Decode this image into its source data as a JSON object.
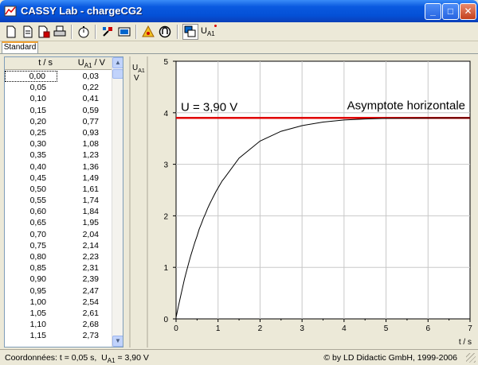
{
  "window": {
    "title": "CASSY Lab - chargeCG2",
    "minimize": "_",
    "maximize": "□",
    "close": "✕"
  },
  "toolbar": {
    "buttons": [
      "new-file-icon",
      "open-file-icon",
      "save-file-icon",
      "print-icon",
      "stopwatch-icon",
      "settings-icon",
      "display-icon",
      "parameters-icon",
      "control-icon",
      "window-icon"
    ],
    "channel_label": "U",
    "channel_sub": "A1"
  },
  "tabs": [
    {
      "label": "Standard"
    }
  ],
  "table": {
    "col1_header": "t / s",
    "col2_header_main": "U",
    "col2_header_sub": "A1",
    "col2_header_unit": " / V",
    "rows": [
      [
        "0,00",
        "0,03"
      ],
      [
        "0,05",
        "0,22"
      ],
      [
        "0,10",
        "0,41"
      ],
      [
        "0,15",
        "0,59"
      ],
      [
        "0,20",
        "0,77"
      ],
      [
        "0,25",
        "0,93"
      ],
      [
        "0,30",
        "1,08"
      ],
      [
        "0,35",
        "1,23"
      ],
      [
        "0,40",
        "1,36"
      ],
      [
        "0,45",
        "1,49"
      ],
      [
        "0,50",
        "1,61"
      ],
      [
        "0,55",
        "1,74"
      ],
      [
        "0,60",
        "1,84"
      ],
      [
        "0,65",
        "1,95"
      ],
      [
        "0,70",
        "2,04"
      ],
      [
        "0,75",
        "2,14"
      ],
      [
        "0,80",
        "2,23"
      ],
      [
        "0,85",
        "2,31"
      ],
      [
        "0,90",
        "2,39"
      ],
      [
        "0,95",
        "2,47"
      ],
      [
        "1,00",
        "2,54"
      ],
      [
        "1,05",
        "2,61"
      ],
      [
        "1,10",
        "2,68"
      ],
      [
        "1,15",
        "2,73"
      ]
    ]
  },
  "chart_data": {
    "type": "line",
    "ylabel_main": "U",
    "ylabel_sub": "A1",
    "ylabel_unit": "V",
    "xlabel": "t / s",
    "xlim": [
      0,
      7
    ],
    "ylim": [
      0,
      5
    ],
    "xticks": [
      "0",
      "1",
      "2",
      "3",
      "4",
      "5",
      "6",
      "7"
    ],
    "yticks": [
      "0",
      "1",
      "2",
      "3",
      "4",
      "5"
    ],
    "grid": true,
    "asymptote_value": 3.9,
    "asymptote_color": "#e00000",
    "asymptote_label": "U = 3,90 V",
    "annotation": "Asymptote horizontale",
    "curve_color": "#000000",
    "series": [
      {
        "x": [
          0,
          0.05,
          0.1,
          0.15,
          0.2,
          0.25,
          0.3,
          0.35,
          0.4,
          0.45,
          0.5,
          0.55,
          0.6,
          0.65,
          0.7,
          0.75,
          0.8,
          0.85,
          0.9,
          0.95,
          1.0,
          1.05,
          1.1,
          1.15,
          1.5,
          2.0,
          2.5,
          3.0,
          3.5,
          4.0,
          4.5,
          5.0,
          5.5,
          6.0,
          6.5,
          7.0
        ],
        "y": [
          0.03,
          0.22,
          0.41,
          0.59,
          0.77,
          0.93,
          1.08,
          1.23,
          1.36,
          1.49,
          1.61,
          1.74,
          1.84,
          1.95,
          2.04,
          2.14,
          2.23,
          2.31,
          2.39,
          2.47,
          2.54,
          2.61,
          2.68,
          2.73,
          3.12,
          3.45,
          3.64,
          3.75,
          3.82,
          3.86,
          3.88,
          3.89,
          3.895,
          3.898,
          3.899,
          3.9
        ]
      }
    ]
  },
  "status": {
    "coords_label": "Coordonnées:",
    "coords_t": "t = 0,05 s,",
    "coords_u": "U",
    "coords_u_sub": "A1",
    "coords_u_value": " = 3,90 V",
    "copyright": "© by LD Didactic GmbH, 1999-2006"
  }
}
